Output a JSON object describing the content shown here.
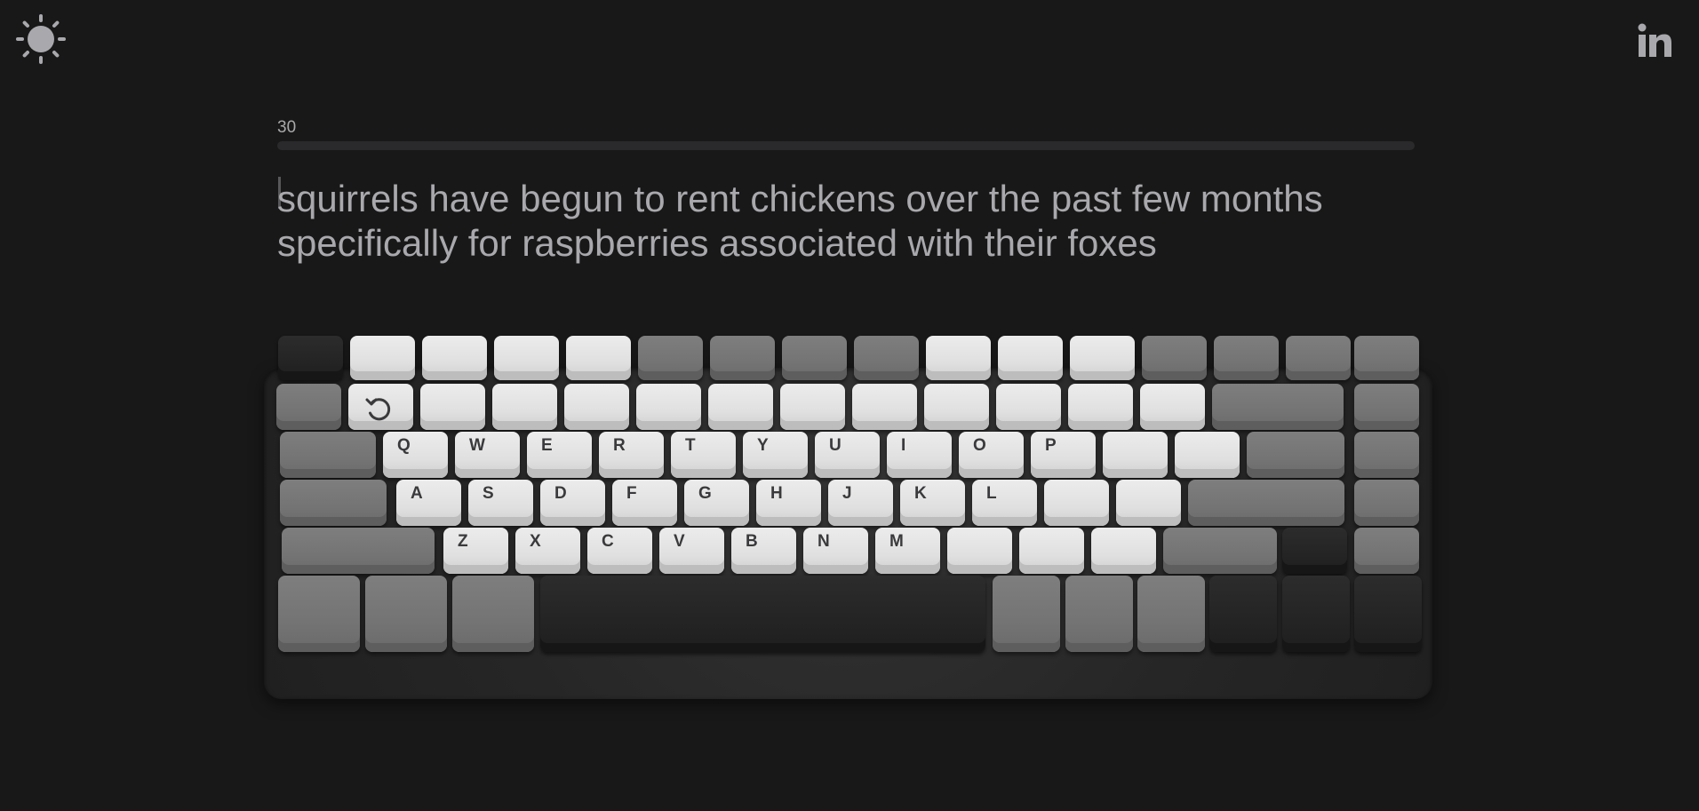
{
  "header": {
    "theme_toggle_icon": "sun-icon",
    "social_icon": "linkedin-icon"
  },
  "test": {
    "timer": "30",
    "progress_fraction": 0.0,
    "text": "squirrels have begun to rent chickens over the past few months specifically for raspberries associated with their foxes"
  },
  "keyboard": {
    "restart_icon": "restart-icon",
    "rows": {
      "qwerty": [
        "Q",
        "W",
        "E",
        "R",
        "T",
        "Y",
        "U",
        "I",
        "O",
        "P"
      ],
      "home": [
        "A",
        "S",
        "D",
        "F",
        "G",
        "H",
        "J",
        "K",
        "L"
      ],
      "bottom": [
        "Z",
        "X",
        "C",
        "V",
        "B",
        "N",
        "M"
      ]
    }
  },
  "colors": {
    "background": "#181818",
    "text": "#a9a9ad",
    "key_white": "#e3e3e3",
    "key_gray": "#777777",
    "key_black": "#262626"
  }
}
